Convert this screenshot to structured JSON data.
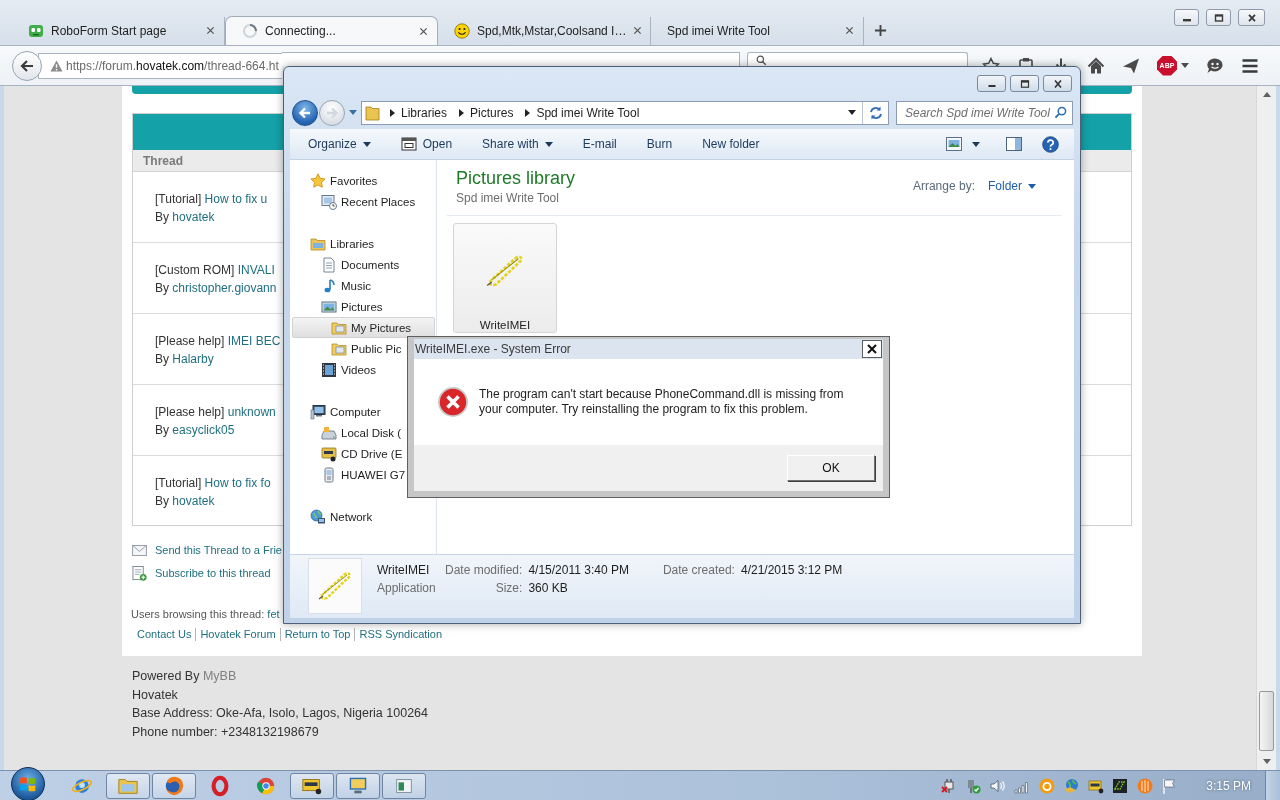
{
  "browser": {
    "tabs": [
      {
        "title": "RoboForm Start page",
        "kind": "robot",
        "selected": false
      },
      {
        "title": "Connecting...",
        "kind": "spinner",
        "selected": true
      },
      {
        "title": "Spd,Mtk,Mstar,Coolsand I…",
        "kind": "smiley",
        "selected": false
      },
      {
        "title": "Spd imei Write Tool",
        "kind": "plain",
        "selected": false
      }
    ],
    "address": {
      "warning": true,
      "prefix": "https://forum.",
      "domain": "hovatek.com",
      "path": "/thread-664.ht"
    },
    "toolbar": [
      {
        "kind": "bookmark",
        "menu": false
      },
      {
        "kind": "clipboard",
        "menu": false
      },
      {
        "kind": "download",
        "menu": false
      },
      {
        "kind": "home",
        "menu": false
      },
      {
        "kind": "send",
        "menu": false
      },
      {
        "kind": "adblock",
        "label": "ABP",
        "menu": true
      },
      {
        "kind": "chat",
        "menu": false
      },
      {
        "kind": "menu",
        "menu": false
      }
    ]
  },
  "forum": {
    "column": "Thread",
    "threads": [
      {
        "prefix": "[Tutorial]",
        "title": "How to fix u",
        "by": "By",
        "author": "hovatek"
      },
      {
        "prefix": "[Custom ROM]",
        "title": "INVALI",
        "by": "By",
        "author": "christopher.giovann"
      },
      {
        "prefix": "[Please help]",
        "title": "IMEI BEC",
        "by": "By",
        "author": "Halarby"
      },
      {
        "prefix": "[Please help]",
        "title": "unknown",
        "by": "By",
        "author": "easyclick05"
      },
      {
        "prefix": "[Tutorial]",
        "title": "How to fix fo",
        "by": "By",
        "author": "hovatek"
      }
    ],
    "actions": [
      {
        "kind": "email",
        "label": "Send this Thread to a Frie"
      },
      {
        "kind": "subscribe",
        "label": "Subscribe to this thread"
      }
    ],
    "browsing": {
      "label": "Users browsing this thread:",
      "users": "fet"
    },
    "links": [
      "Contact Us",
      "Hovatek Forum",
      "Return to Top",
      "RSS Syndication"
    ],
    "footer": {
      "powered_by": "Powered By",
      "engine": "MyBB",
      "lines": [
        "Hovatek",
        "Base Address: Oke-Afa, Isolo, Lagos, Nigeria 100264",
        "Phone number: +2348132198679"
      ]
    }
  },
  "explorer": {
    "history": [
      {
        "kind": "back",
        "disabled": false
      },
      {
        "kind": "forward",
        "disabled": true
      }
    ],
    "breadcrumb": [
      "Libraries",
      "Pictures",
      "Spd imei Write Tool"
    ],
    "search": {
      "placeholder": "Search Spd imei Write Tool"
    },
    "commands": [
      {
        "label": "Organize",
        "kind": "plain",
        "menu": true
      },
      {
        "label": "Open",
        "kind": "open",
        "menu": false
      },
      {
        "label": "Share with",
        "kind": "plain",
        "menu": true
      },
      {
        "label": "E-mail",
        "kind": "plain",
        "menu": false
      },
      {
        "label": "Burn",
        "kind": "plain",
        "menu": false
      },
      {
        "label": "New folder",
        "kind": "plain",
        "menu": false
      }
    ],
    "sidebar": [
      {
        "label": "Favorites",
        "kind": "star",
        "selected": false,
        "children": [
          {
            "label": "Recent Places",
            "kind": "recent",
            "selected": false
          }
        ]
      },
      {
        "label": "Libraries",
        "kind": "library",
        "selected": false,
        "children": [
          {
            "label": "Documents",
            "kind": "document",
            "selected": false
          },
          {
            "label": "Music",
            "kind": "music",
            "selected": false
          },
          {
            "label": "Pictures",
            "kind": "picture",
            "selected": false,
            "children": [
              {
                "label": "My Pictures",
                "kind": "folder",
                "selected": true
              },
              {
                "label": "Public Pic",
                "kind": "folder",
                "selected": false
              }
            ]
          },
          {
            "label": "Videos",
            "kind": "film",
            "selected": false
          }
        ]
      },
      {
        "label": "Computer",
        "kind": "computer",
        "selected": false,
        "children": [
          {
            "label": "Local Disk (",
            "kind": "disk",
            "selected": false
          },
          {
            "label": "CD Drive (E",
            "kind": "cd",
            "selected": false
          },
          {
            "label": "HUAWEI G7",
            "kind": "phone",
            "selected": false
          }
        ]
      },
      {
        "label": "Network",
        "kind": "network",
        "selected": false
      }
    ],
    "library": {
      "title": "Pictures library",
      "subtitle": "Spd imei Write Tool",
      "arrange_label": "Arrange by:",
      "arrange_value": "Folder"
    },
    "files": [
      {
        "name": "WriteIMEI",
        "kind": "application",
        "selected": true
      }
    ],
    "details": {
      "kind": "application",
      "name": "WriteIMEI",
      "type": "Application",
      "columns": [
        [
          {
            "label": "Date modified:",
            "value": "4/15/2011 3:40 PM"
          },
          {
            "label": "Size:",
            "value": "360 KB"
          }
        ],
        [
          {
            "label": "Date created:",
            "value": "4/21/2015 3:12 PM"
          }
        ]
      ]
    }
  },
  "dialog": {
    "title": "WriteIMEI.exe - System Error",
    "kind": "error",
    "message": "The program can't start because PhoneCommand.dll is missing from your computer. Try reinstalling the program to fix this problem.",
    "buttons": [
      "OK"
    ]
  },
  "taskbar": {
    "apps": [
      {
        "kind": "sphere",
        "open": false
      },
      {
        "kind": "folder",
        "open": true
      },
      {
        "kind": "globe",
        "open": true
      },
      {
        "kind": "ring",
        "open": false
      },
      {
        "kind": "wheel",
        "open": false
      },
      {
        "kind": "card",
        "open": true
      },
      {
        "kind": "monitor",
        "open": true
      },
      {
        "kind": "window",
        "open": true
      }
    ],
    "tray": [
      {
        "kind": "plug"
      },
      {
        "kind": "plugcheck"
      },
      {
        "kind": "speaker"
      },
      {
        "kind": "signal"
      },
      {
        "kind": "ring"
      },
      {
        "kind": "globe"
      },
      {
        "kind": "card"
      },
      {
        "kind": "chip"
      },
      {
        "kind": "ball"
      },
      {
        "kind": "flag"
      }
    ],
    "time": "3:15 PM"
  }
}
